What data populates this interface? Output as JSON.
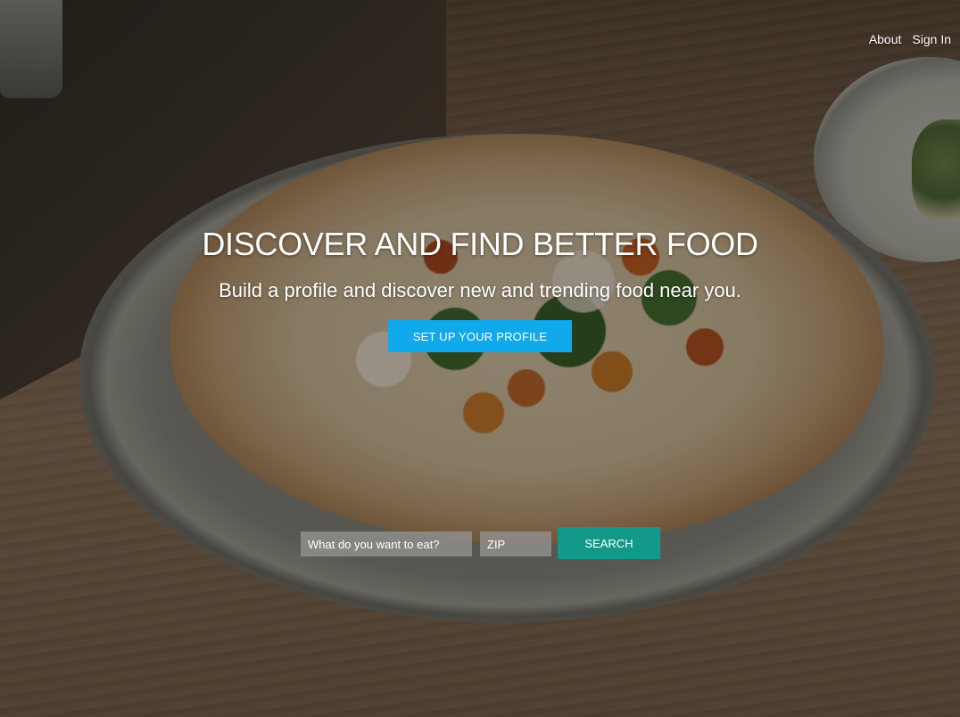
{
  "nav": {
    "about": "About",
    "sign_in": "Sign In"
  },
  "hero": {
    "headline": "DISCOVER AND FIND BETTER FOOD",
    "subhead": "Build a profile and discover new and trending food near you.",
    "cta_label": "SET UP YOUR PROFILE"
  },
  "search": {
    "food_placeholder": "What do you want to eat?",
    "zip_placeholder": "ZIP",
    "button_label": "SEARCH"
  },
  "colors": {
    "cta": "#10a9ec",
    "search_button": "#13998a"
  }
}
